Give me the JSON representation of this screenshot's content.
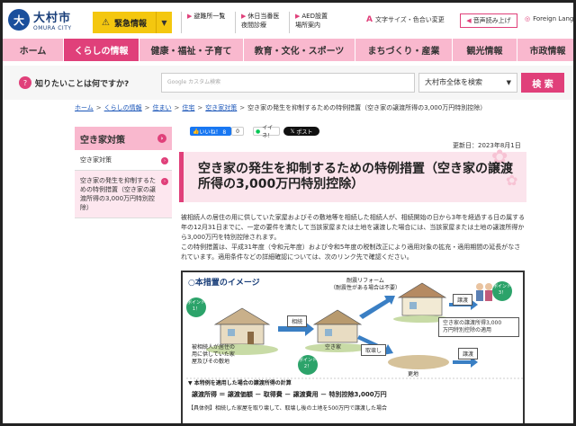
{
  "header": {
    "logo_mark": "大",
    "logo_ja": "大村市",
    "logo_en": "OMURA CITY",
    "emergency_label": "緊急情報",
    "quick_links": [
      "避難所一覧",
      "休日当番医\n夜間診療",
      "AED設置\n場所案内"
    ],
    "text_size_label": "文字サイズ・色合い変更",
    "voice_label": "音声読み上げ",
    "lang_label": "Foreign Language"
  },
  "nav": [
    "ホーム",
    "くらしの情報",
    "健康・福祉・子育て",
    "教育・文化・スポーツ",
    "まちづくり・産業",
    "観光情報",
    "市政情報"
  ],
  "search": {
    "label": "知りたいことは何ですか?",
    "placeholder": "Google カスタム検索",
    "scope": "大村市全体を検索",
    "button": "検 索"
  },
  "breadcrumb": [
    "ホーム",
    "くらしの情報",
    "住まい",
    "住宅",
    "空き家対策",
    "空き家の発生を抑制するための特例措置（空き家の譲渡所得の3,000万円特別控除）"
  ],
  "sidebar": {
    "title": "空き家対策",
    "items": [
      "空き家対策",
      "空き家の発生を抑制するための特例措置（空き家の譲渡所得の3,000万円特別控除）"
    ]
  },
  "social": {
    "like": "いいね！ 8",
    "like_count": "0",
    "line": "イイネ！",
    "x_post": "ポスト"
  },
  "updated": "更新日：2023年8月1日",
  "title": "空き家の発生を抑制するための特例措置（空き家の譲渡所得の3,000万円特別控除）",
  "body": [
    "被相続人の居住の用に供していた家屋およびその敷地等を相続した相続人が、相続開始の日から3年を経過する日の属する年の12月31日までに、一定の要件を満たして当該家屋または土地を譲渡した場合には、当該家屋または土地の譲渡所得から3,000万円を特別控除されます。",
    "この特例措置は、平成31年度（令和元年度）および令和5年度の税制改正により適用対象の拡充・適用期間の延長がなされています。適用条件などの詳細確認については、次のリンク先で確認ください。"
  ],
  "image": {
    "heading": "○本措置のイメージ",
    "renovation": "耐震リフォーム\n（耐震性がある場合は不要）",
    "point1": "ポイント\n1！",
    "point2": "ポイント\n2！",
    "point3": "ポイント\n3！",
    "inherit": "相続",
    "vacant": "空き家",
    "demolish": "取壊し",
    "transfer1": "譲渡",
    "transfer2": "譲渡",
    "vacant_land": "更地",
    "deceased": "被相続人が居住の\n用に供していた家\n屋及びその敷地",
    "result": "空き家の譲渡所得3,000\n万円特別控除の適用",
    "calc_head": "▼ 本特例を適用した場合の譲渡所得の計算",
    "calc": "譲渡所得 ＝ 譲渡価額 － 取得費 － 譲渡費用 － 特別控除3,000万円",
    "example": "【具体例】相続した家屋を取り壊して、取壊し後の土地を500万円で譲渡した場合"
  }
}
